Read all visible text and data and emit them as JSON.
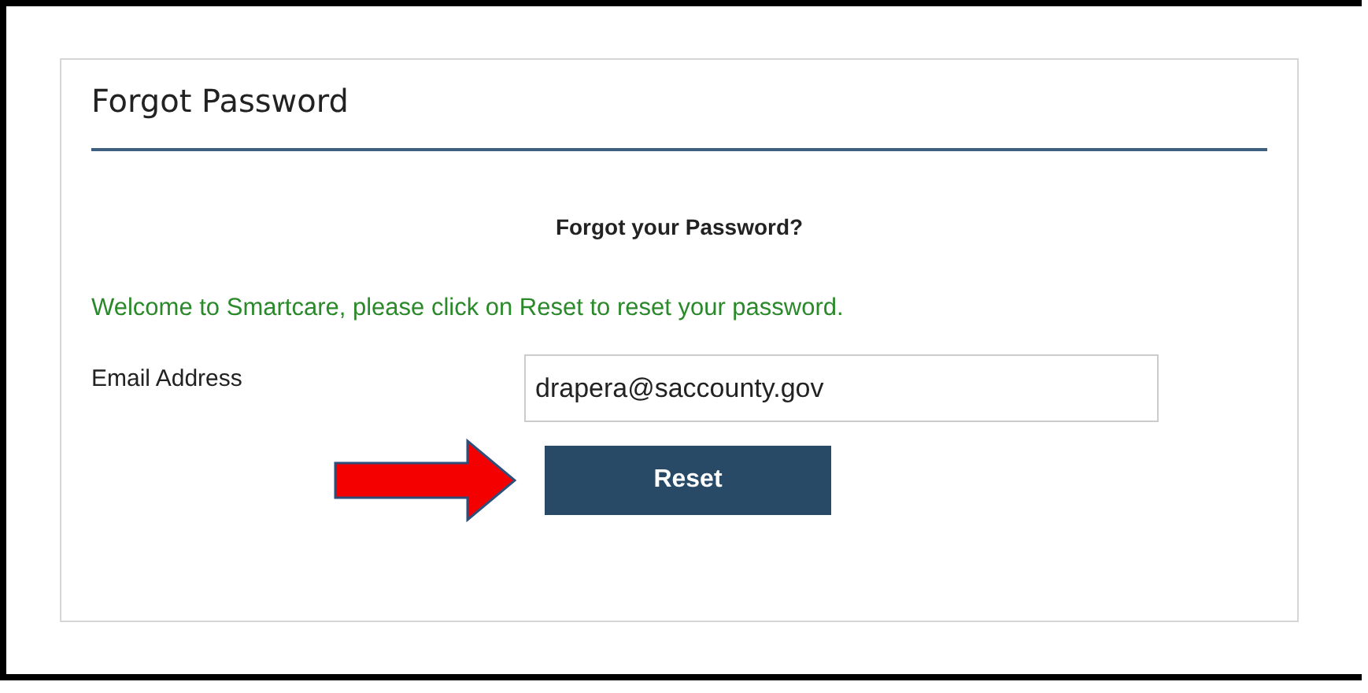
{
  "panel": {
    "title": "Forgot Password",
    "heading": "Forgot your Password?",
    "message": "Welcome to Smartcare, please click on Reset to reset your password.",
    "email": {
      "label": "Email Address",
      "value": "drapera@saccounty.gov"
    },
    "button": "Reset"
  }
}
